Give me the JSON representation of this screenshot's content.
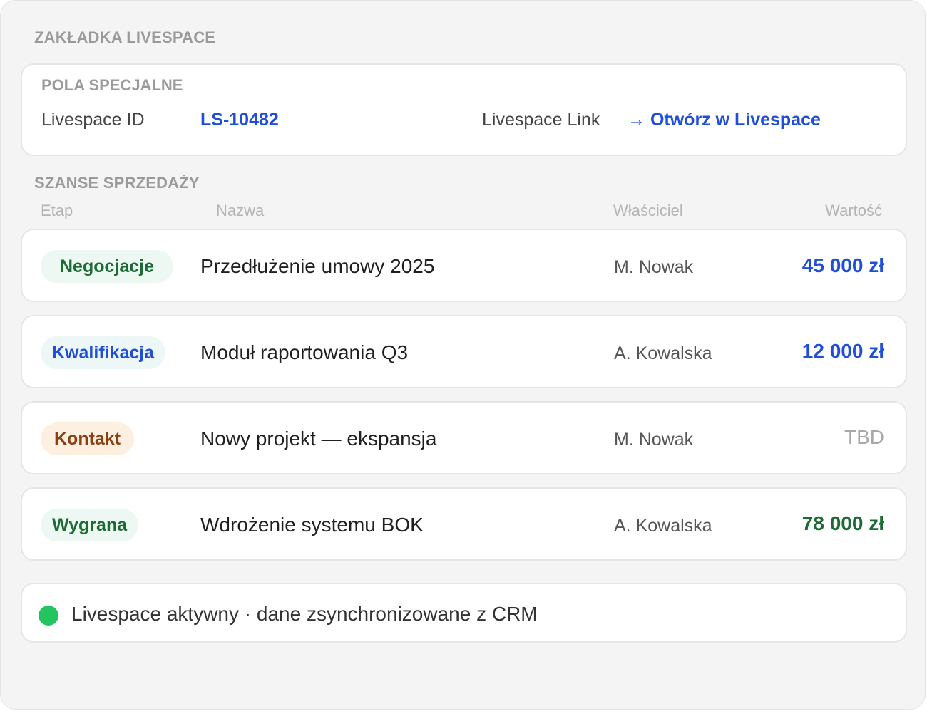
{
  "tab_title": "ZAKŁADKA LIVESPACE",
  "special_fields": {
    "title": "POLA SPECJALNE",
    "id_label": "Livespace ID",
    "id_value": "LS-10482",
    "link_label": "Livespace Link",
    "link_icon": "→",
    "link_text": "Otwórz w Livespace"
  },
  "opportunities": {
    "title": "SZANSE SPRZEDAŻY",
    "columns": {
      "stage": "Etap",
      "name": "Nazwa",
      "owner": "Właściciel",
      "value": "Wartość"
    },
    "rows": [
      {
        "stage": "Negocjacje",
        "stage_color": "#1c6b34",
        "name": "Przedłużenie umowy 2025",
        "owner": "M. Nowak",
        "value": "45 000 zł",
        "value_color": "#1f4fd8"
      },
      {
        "stage": "Kwalifikacja",
        "stage_color": "#1f4fd8",
        "name": "Moduł raportowania Q3",
        "owner": "A. Kowalska",
        "value": "12 000 zł",
        "value_color": "#1f4fd8"
      },
      {
        "stage": "Kontakt",
        "stage_color": "#8b3f12",
        "name": "Nowy projekt — ekspansja",
        "owner": "M. Nowak",
        "value": "TBD",
        "value_color": "#a8a8a8"
      },
      {
        "stage": "Wygrana",
        "stage_color": "#1c6b34",
        "name": "Wdrożenie systemu BOK",
        "owner": "A. Kowalska",
        "value": "78 000 zł",
        "value_color": "#1c6b34"
      }
    ]
  },
  "status": {
    "text": "Livespace aktywny · dane zsynchronizowane z CRM",
    "color": "#22c55e"
  }
}
